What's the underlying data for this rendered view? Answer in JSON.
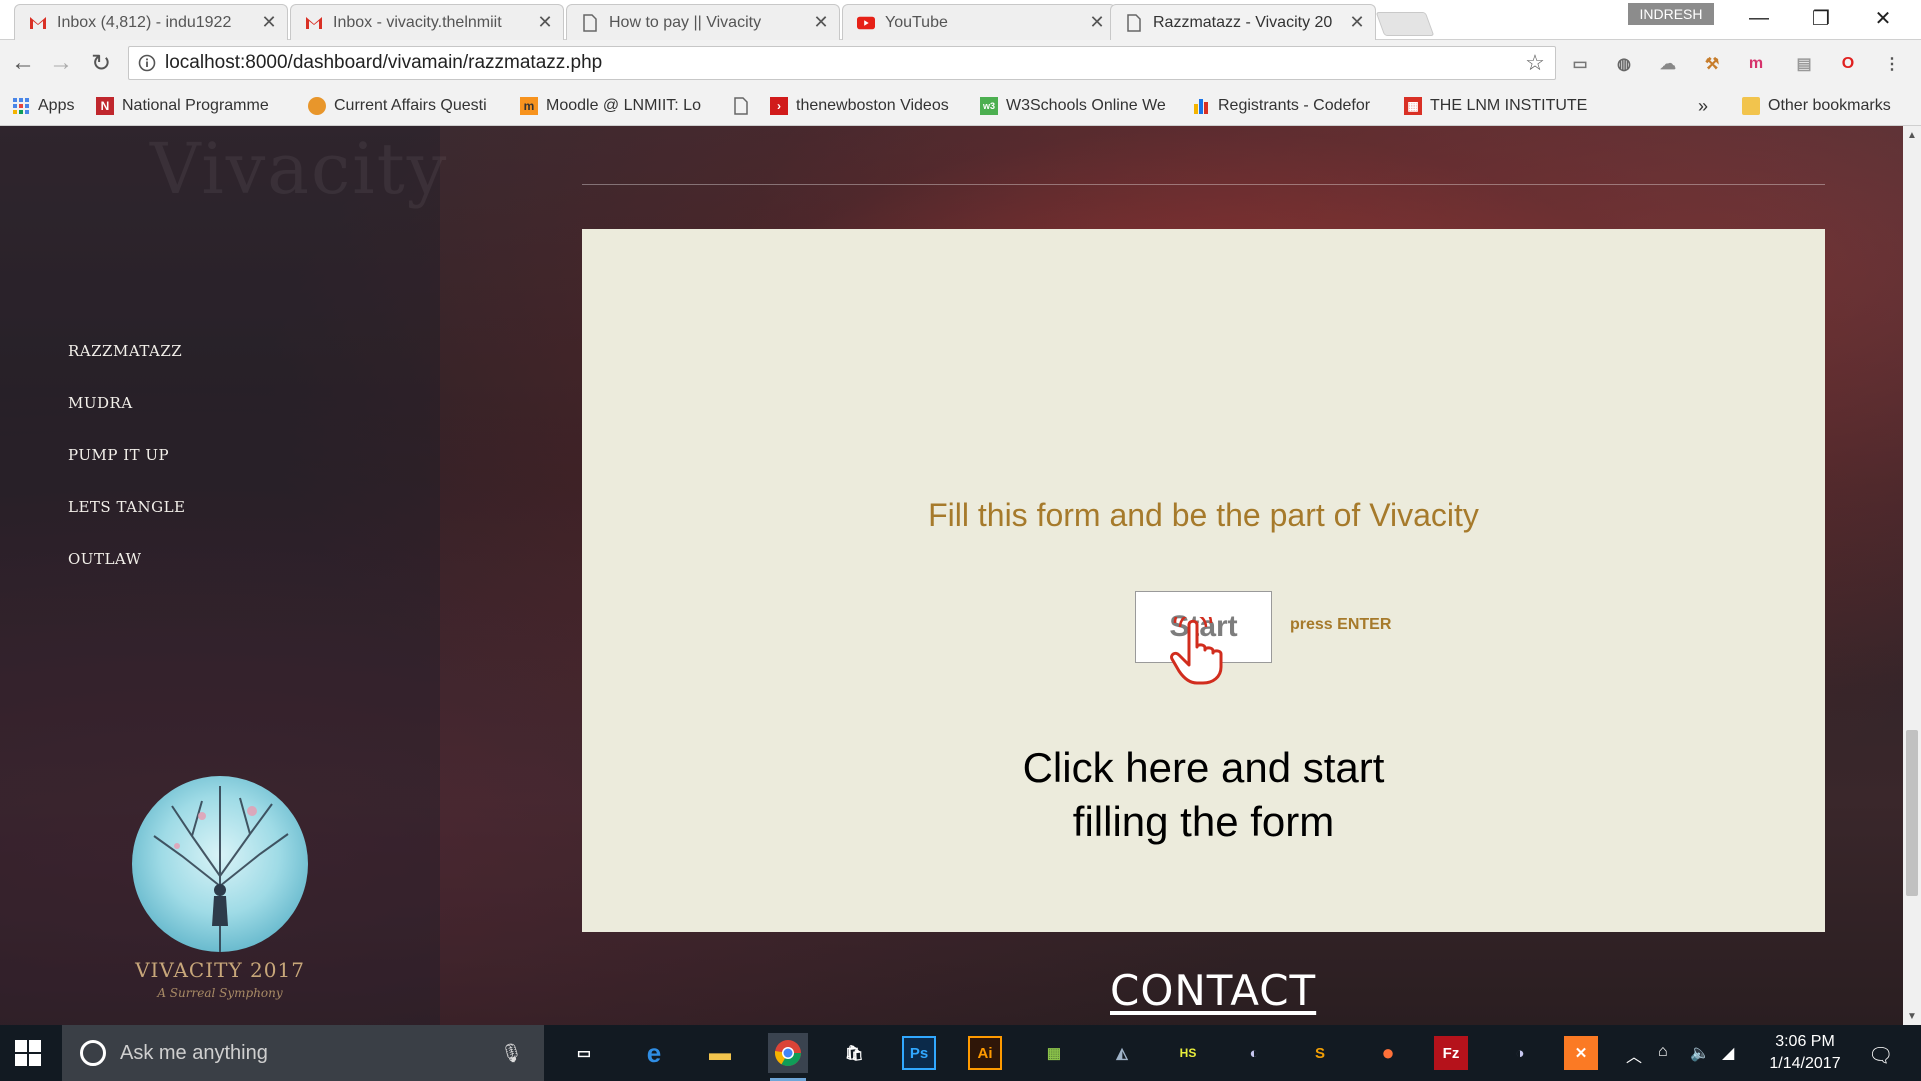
{
  "browser": {
    "tabs": [
      {
        "title": "Inbox (4,812) - indu1922",
        "icon": "gmail-icon"
      },
      {
        "title": "Inbox - vivacity.thelnmiit",
        "icon": "gmail-icon"
      },
      {
        "title": "How to pay || Vivacity",
        "icon": "page-icon"
      },
      {
        "title": "YouTube",
        "icon": "youtube-icon"
      },
      {
        "title": "Razzmatazz - Vivacity 20",
        "icon": "page-icon",
        "active": true
      }
    ],
    "user_badge": "INDRESH",
    "url": "localhost:8000/dashboard/vivamain/razzmatazz.php",
    "bookmarks": [
      {
        "label": "Apps",
        "icon": "apps-grid-icon"
      },
      {
        "label": "National Programme",
        "icon": "nptel-icon"
      },
      {
        "label": "Current Affairs Questi",
        "icon": "award-icon"
      },
      {
        "label": "Moodle @ LNMIIT: Lo",
        "icon": "moodle-icon"
      },
      {
        "label": "",
        "icon": "page-icon"
      },
      {
        "label": "thenewboston Videos",
        "icon": "thenewboston-icon"
      },
      {
        "label": "W3Schools Online We",
        "icon": "w3schools-icon"
      },
      {
        "label": "Registrants - Codefor",
        "icon": "bar-chart-icon"
      },
      {
        "label": "THE LNM INSTITUTE",
        "icon": "lnmiit-icon"
      }
    ],
    "overflow": "»",
    "other_bookmarks": "Other bookmarks"
  },
  "page": {
    "sidebar": {
      "items": [
        "RAZZMATAZZ",
        "MUDRA",
        "PUMP IT UP",
        "LETS TANGLE",
        "OUTLAW"
      ],
      "logo_caption": "VIVACITY 2017",
      "logo_tagline": "A Surreal Symphony"
    },
    "form_card": {
      "heading": "Fill this form and be the part of Vivacity",
      "start_label": "Start",
      "hint": "press ENTER",
      "annotation_line1": "Click here and start",
      "annotation_line2": "filling the form"
    },
    "contact_label": "CONTACT"
  },
  "taskbar": {
    "search_placeholder": "Ask me anything",
    "time": "3:06 PM",
    "date": "1/14/2017"
  },
  "colors": {
    "card_bg": "#ecebdc",
    "heading_gold": "#a67a2b",
    "taskbar_bg": "#121a22"
  }
}
